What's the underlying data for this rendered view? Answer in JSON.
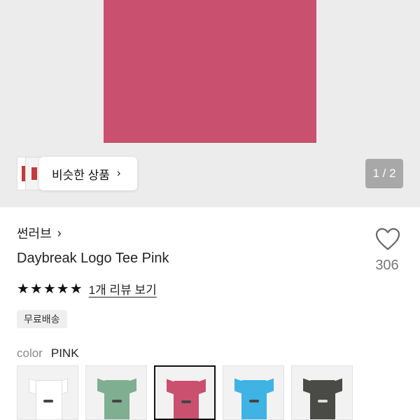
{
  "gallery": {
    "similar_label": "비슷한 상품",
    "similar_chevron": "›",
    "pager": "1 / 2"
  },
  "product": {
    "brand": "썬러브",
    "brand_chevron": "›",
    "title": "Daybreak Logo Tee Pink",
    "stars": "★★★★★",
    "rating": 5,
    "review_link": "1개 리뷰 보기",
    "shipping_badge": "무료배송",
    "likes": "306",
    "heart_icon": "heart-outline-icon"
  },
  "color": {
    "label": "color",
    "value": "PINK",
    "options": [
      {
        "name": "white",
        "hex": "#ffffff",
        "selected": false
      },
      {
        "name": "green",
        "hex": "#7fae91",
        "selected": false
      },
      {
        "name": "pink",
        "hex": "#c9506f",
        "selected": true
      },
      {
        "name": "blue",
        "hex": "#3fb3e3",
        "selected": false
      },
      {
        "name": "charcoal",
        "hex": "#4a4a46",
        "selected": false
      }
    ]
  },
  "colors": {
    "shirt": "#c9506f",
    "hero_bg": "#ececec"
  }
}
